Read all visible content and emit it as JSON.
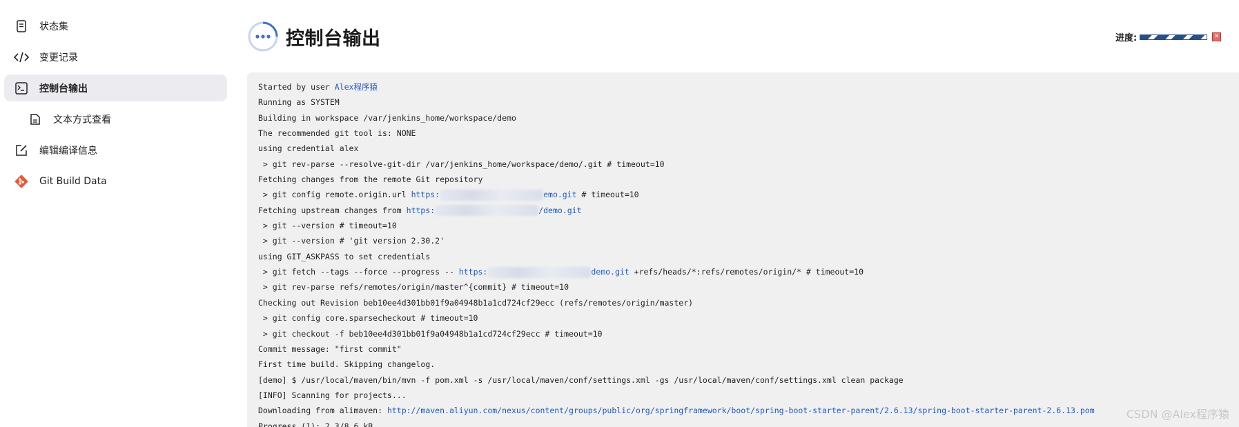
{
  "sidebar": {
    "items": [
      {
        "label": "状态集",
        "icon": "document-icon"
      },
      {
        "label": "变更记录",
        "icon": "code-icon"
      },
      {
        "label": "控制台输出",
        "icon": "terminal-icon"
      },
      {
        "label": "文本方式查看",
        "icon": "file-text-icon"
      },
      {
        "label": "编辑编译信息",
        "icon": "edit-icon"
      },
      {
        "label": "Git Build Data",
        "icon": "git-icon"
      }
    ]
  },
  "header": {
    "title": "控制台输出",
    "progress_label": "进度:",
    "stop_label": "✕"
  },
  "console": {
    "line_0_text": "Started by user ",
    "line_0_link": "Alex程序猿",
    "line_1": "Running as SYSTEM",
    "line_2": "Building in workspace /var/jenkins_home/workspace/demo",
    "line_3": "The recommended git tool is: NONE",
    "line_4": "using credential alex",
    "line_5": " > git rev-parse --resolve-git-dir /var/jenkins_home/workspace/demo/.git # timeout=10",
    "line_6": "Fetching changes from the remote Git repository",
    "line_7_pre": " > git config remote.origin.url ",
    "line_7_link_a": "https:",
    "line_7_link_b": "emo.git",
    "line_7_post": " # timeout=10",
    "line_8_pre": "Fetching upstream changes from ",
    "line_8_link_a": "https:",
    "line_8_link_b": "/demo.git",
    "line_9": " > git --version # timeout=10",
    "line_10": " > git --version # 'git version 2.30.2'",
    "line_11": "using GIT_ASKPASS to set credentials",
    "line_12_pre": " > git fetch --tags --force --progress -- ",
    "line_12_link_a": "https:",
    "line_12_link_b": "demo.git",
    "line_12_post": " +refs/heads/*:refs/remotes/origin/* # timeout=10",
    "line_13": " > git rev-parse refs/remotes/origin/master^{commit} # timeout=10",
    "line_14": "Checking out Revision beb10ee4d301bb01f9a04948b1a1cd724cf29ecc (refs/remotes/origin/master)",
    "line_15": " > git config core.sparsecheckout # timeout=10",
    "line_16": " > git checkout -f beb10ee4d301bb01f9a04948b1a1cd724cf29ecc # timeout=10",
    "line_17": "Commit message: \"first commit\"",
    "line_18": "First time build. Skipping changelog.",
    "line_19": "[demo] $ /usr/local/maven/bin/mvn -f pom.xml -s /usr/local/maven/conf/settings.xml -gs /usr/local/maven/conf/settings.xml clean package",
    "line_20": "[INFO] Scanning for projects...",
    "line_21_pre": "Downloading from alimaven: ",
    "line_21_link": "http://maven.aliyun.com/nexus/content/groups/public/org/springframework/boot/spring-boot-starter-parent/2.6.13/spring-boot-starter-parent-2.6.13.pom",
    "line_22": "Progress (1): 2.3/8.6 kB"
  },
  "watermark": "CSDN @Alex程序猿",
  "colors": {
    "link": "#1d58c6",
    "console_bg": "#f0f0f1",
    "active_bg": "#ececf0",
    "title_icon": "#3f72c6"
  }
}
